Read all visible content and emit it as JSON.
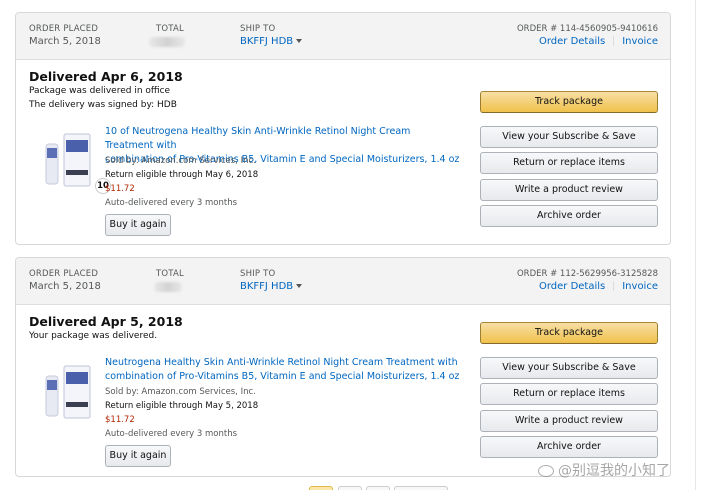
{
  "orders": [
    {
      "header": {
        "order_placed_label": "ORDER PLACED",
        "order_placed_value": "March 5, 2018",
        "total_label": "TOTAL",
        "ship_to_label": "SHIP TO",
        "ship_to_value": "BKFFJ HDB",
        "order_number": "ORDER # 114-4560905-9410616",
        "details_link": "Order Details",
        "invoice_link": "Invoice"
      },
      "status": "Delivered Apr 6, 2018",
      "status_lines": [
        "Package was delivered in office",
        "The delivery was signed by: HDB"
      ],
      "item": {
        "quantity": "10",
        "title_line1": "10 of Neutrogena Healthy Skin Anti-Wrinkle Retinol Night Cream Treatment with",
        "title_line2": "combination of Pro-Vitamins B5, Vitamin E and Special Moisturizers, 1.4 oz",
        "sold_by": "Sold by: Amazon.com Services, Inc.",
        "return_eligible": "Return eligible through May 6, 2018",
        "price": "$11.72",
        "auto_delivered": "Auto-delivered every 3 months",
        "buy_again": "Buy it again"
      },
      "actions": [
        "Track package",
        "View your Subscribe & Save",
        "Return or replace items",
        "Write a product review",
        "Archive order"
      ]
    },
    {
      "header": {
        "order_placed_label": "ORDER PLACED",
        "order_placed_value": "March 5, 2018",
        "total_label": "TOTAL",
        "ship_to_label": "SHIP TO",
        "ship_to_value": "BKFFJ HDB",
        "order_number": "ORDER # 112-5629956-3125828",
        "details_link": "Order Details",
        "invoice_link": "Invoice"
      },
      "status": "Delivered Apr 5, 2018",
      "status_lines": [
        "Your package was delivered."
      ],
      "item": {
        "title_line1": "Neutrogena Healthy Skin Anti-Wrinkle Retinol Night Cream Treatment with",
        "title_line2": "combination of Pro-Vitamins B5, Vitamin E and Special Moisturizers, 1.4 oz",
        "sold_by": "Sold by: Amazon.com Services, Inc.",
        "return_eligible": "Return eligible through May 5, 2018",
        "price": "$11.72",
        "auto_delivered": "Auto-delivered every 3 months",
        "buy_again": "Buy it again"
      },
      "actions": [
        "Track package",
        "View your Subscribe & Save",
        "Return or replace items",
        "Write a product review",
        "Archive order"
      ]
    }
  ],
  "watermark": "@别逗我的小知了",
  "colors": {
    "link": "#0066c0",
    "price": "#b12704",
    "primary_button": "#f0c14b"
  }
}
